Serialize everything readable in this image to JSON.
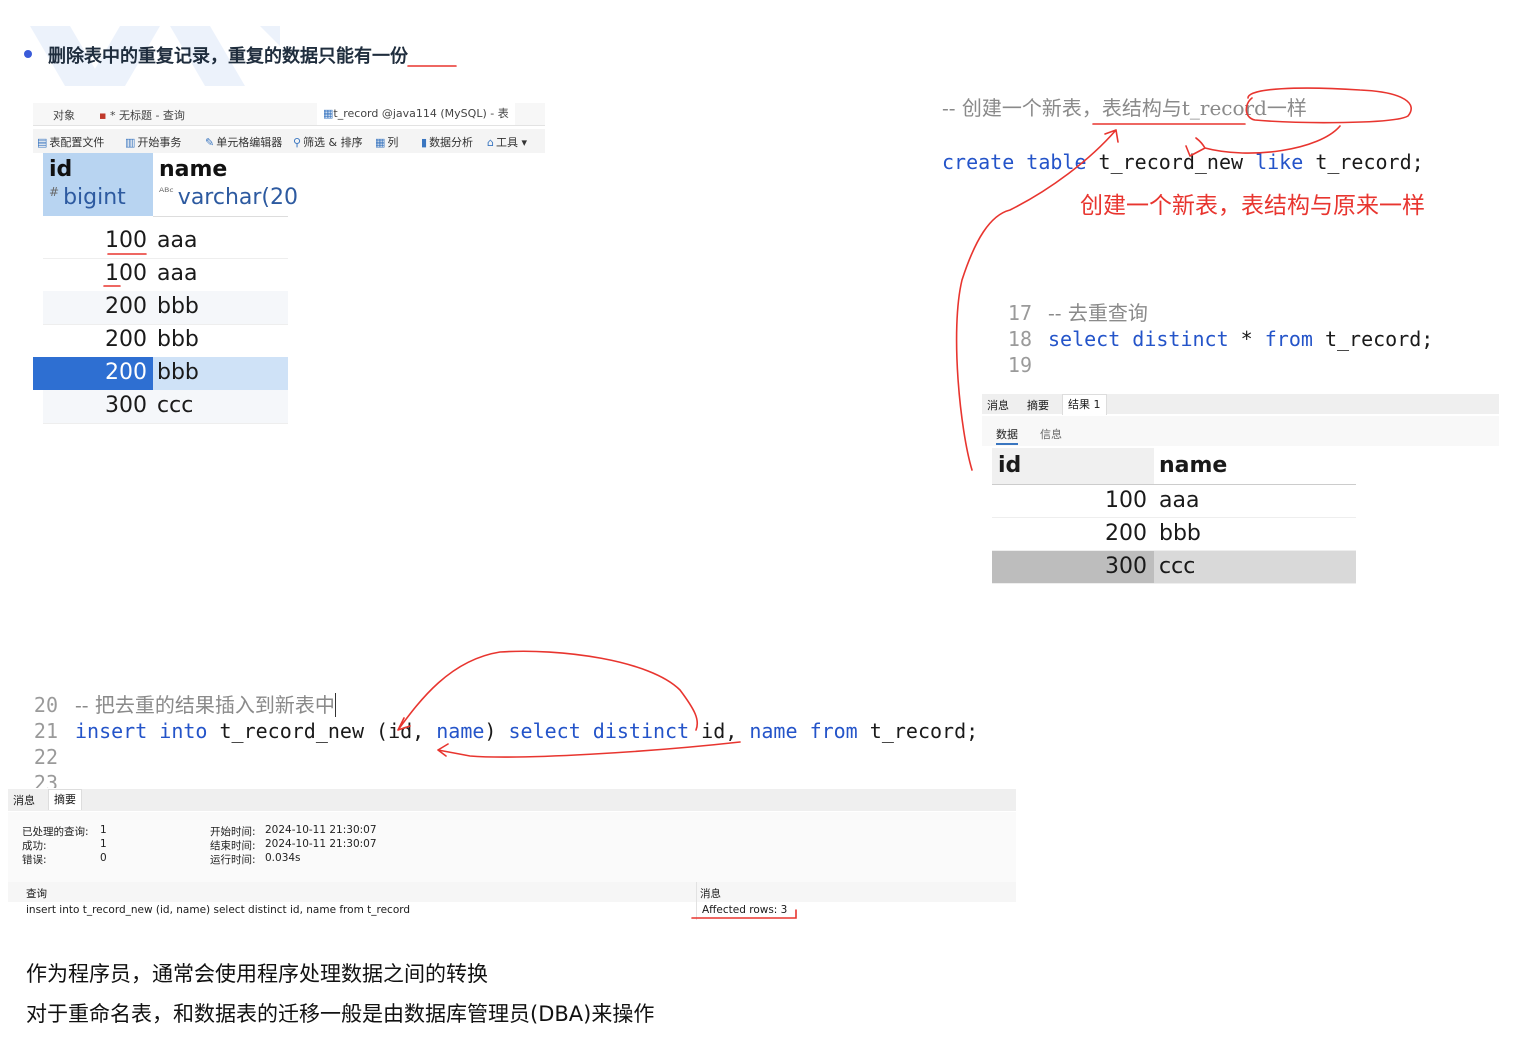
{
  "heading": {
    "bullet_text": "删除表中的重复记录，重复的数据只能有一份"
  },
  "left_window": {
    "tabs": [
      "对象",
      "* 无标题 - 查询",
      "t_record @java114 (MySQL) - 表"
    ],
    "toolbar": [
      "表配置文件",
      "开始事务",
      "单元格编辑器",
      "筛选 & 排序",
      "列",
      "数据分析",
      "工具"
    ],
    "columns": [
      {
        "name": "id",
        "type": "bigint"
      },
      {
        "name": "name",
        "type": "varchar(20"
      }
    ],
    "rows": [
      {
        "id": "100",
        "name": "aaa"
      },
      {
        "id": "100",
        "name": "aaa"
      },
      {
        "id": "200",
        "name": "bbb"
      },
      {
        "id": "200",
        "name": "bbb"
      },
      {
        "id": "200",
        "name": "bbb"
      },
      {
        "id": "300",
        "name": "ccc"
      }
    ]
  },
  "top_code": {
    "line1": "-- 创建一个新表，表结构与t_record一样",
    "kw1": "create table",
    "ident1": "t_record_new",
    "kw2": "like",
    "ident2": "t_record;"
  },
  "annotation_note": "创建一个新表，表结构与原来一样",
  "right_editor": {
    "lines": [
      {
        "num": "17",
        "comment": "-- 去重查询"
      },
      {
        "num": "18",
        "kw1": "select distinct",
        "mid": " * ",
        "kw2": "from",
        "rest": " t_record;"
      },
      {
        "num": "19"
      }
    ],
    "result_tabs": [
      "消息",
      "摘要",
      "结果 1"
    ],
    "sub_tabs": [
      "数据",
      "信息"
    ],
    "columns": [
      "id",
      "name"
    ],
    "rows": [
      {
        "id": "100",
        "name": "aaa"
      },
      {
        "id": "200",
        "name": "bbb"
      },
      {
        "id": "300",
        "name": "ccc"
      }
    ]
  },
  "bottom_editor": {
    "lines": [
      {
        "num": "20",
        "comment": "-- 把去重的结果插入到新表中"
      },
      {
        "num": "21",
        "kw1": "insert into",
        "p1": " t_record_new (id, ",
        "kw2": "name",
        "p2": ") ",
        "kw3": "select distinct",
        "p3": " id, ",
        "kw4": "name",
        "p4": " ",
        "kw5": "from",
        "p5": " t_record;"
      },
      {
        "num": "22"
      },
      {
        "num": "23"
      }
    ],
    "tabs": [
      "消息",
      "摘要"
    ],
    "summary": {
      "processed_label": "已处理的查询:",
      "processed": "1",
      "success_label": "成功:",
      "success": "1",
      "error_label": "错误:",
      "error": "0",
      "start_label": "开始时间:",
      "start": "2024-10-11 21:30:07",
      "end_label": "结束时间:",
      "end": "2024-10-11 21:30:07",
      "run_label": "运行时间:",
      "run": "0.034s"
    },
    "table_head": {
      "query": "查询",
      "message": "消息"
    },
    "table_row": {
      "query": "insert into t_record_new (id, name) select distinct id, name from t_record",
      "message": "Affected rows: 3"
    }
  },
  "footer": {
    "line1": "作为程序员，通常会使用程序处理数据之间的转换",
    "line2": "对于重命名表，和数据表的迁移一般是由数据库管理员(DBA)来操作"
  },
  "colors": {
    "keyword": "#2454c9",
    "comment": "#8a8a8a",
    "annotation": "#e8352f",
    "selection": "#2e6fd2",
    "bullet": "#3a5bd9"
  }
}
